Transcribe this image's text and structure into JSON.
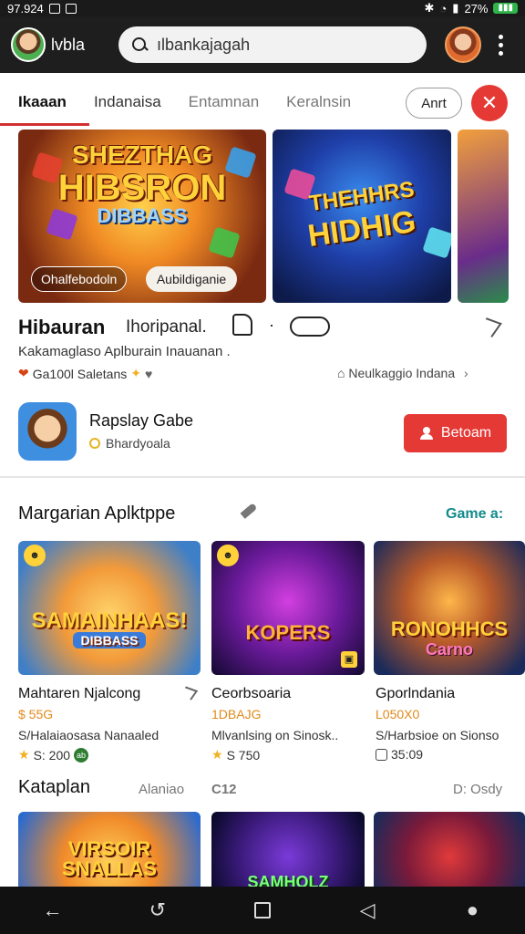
{
  "status": {
    "time": "97.924",
    "battery": "27%"
  },
  "appbar": {
    "name": "lvbla",
    "search_value": "ılbankajagah"
  },
  "tabs": [
    "Ikaaan",
    "Indanaisa",
    "Entamnan",
    "Keralnsin"
  ],
  "tab_pill": "Anrt",
  "close_symbol": "✕",
  "banners": [
    {
      "line1": "SHEZTHAG",
      "line2": "HIBSRON",
      "line3": "DIBBASS",
      "chip_left": "Ohalfebodoln",
      "chip_right": "Aubildiganie"
    },
    {
      "line1": "THEHHRS",
      "line2": "HIDHIG"
    }
  ],
  "featured": {
    "title": "Hibauran",
    "subtitle": "Ihoripanal.",
    "dot": "·",
    "description": "Kakamaglaso Aplburain Inauanan .",
    "meta_left": "Ga100l Saletans",
    "meta_right": "Neulkaggio Indana"
  },
  "app": {
    "name": "Rapslay Gabe",
    "developer": "Bhardyoala",
    "install_label": "Betoam"
  },
  "section1": {
    "title": "Margarian Aplktppe",
    "link": "Game a:"
  },
  "cards": [
    {
      "image_caption": "SAMAINHAAS!",
      "image_caption2": "DIBBASS",
      "title": "Mahtaren Njalcong",
      "price": "$ 55G",
      "desc": "S/Halaiaosasa Nanaaled",
      "rating": "S: 200",
      "badge": "ab"
    },
    {
      "image_caption": "KOPERS",
      "title": "Ceorbsoaria",
      "price": "1DBAJG",
      "desc": "Mlvanlsing on Sinosk..",
      "rating": "S 750"
    },
    {
      "image_caption": "RONOHHCS",
      "image_caption2": "Carno",
      "title": "Gporlndania",
      "price": "L050X0",
      "desc": "S/Harbsioe on Sionso",
      "rating": "35:09"
    }
  ],
  "section2": {
    "title": "Kataplan",
    "label_a": "Alaniao",
    "label_b": "C12",
    "label_c": "D: Osdy"
  },
  "row2": [
    {
      "caption": "VIRSOIR SNALLAS"
    },
    {
      "caption": "SAMHOLZ"
    },
    {
      "caption": ""
    }
  ],
  "nav": {
    "back": "‹",
    "recents": "◁"
  }
}
